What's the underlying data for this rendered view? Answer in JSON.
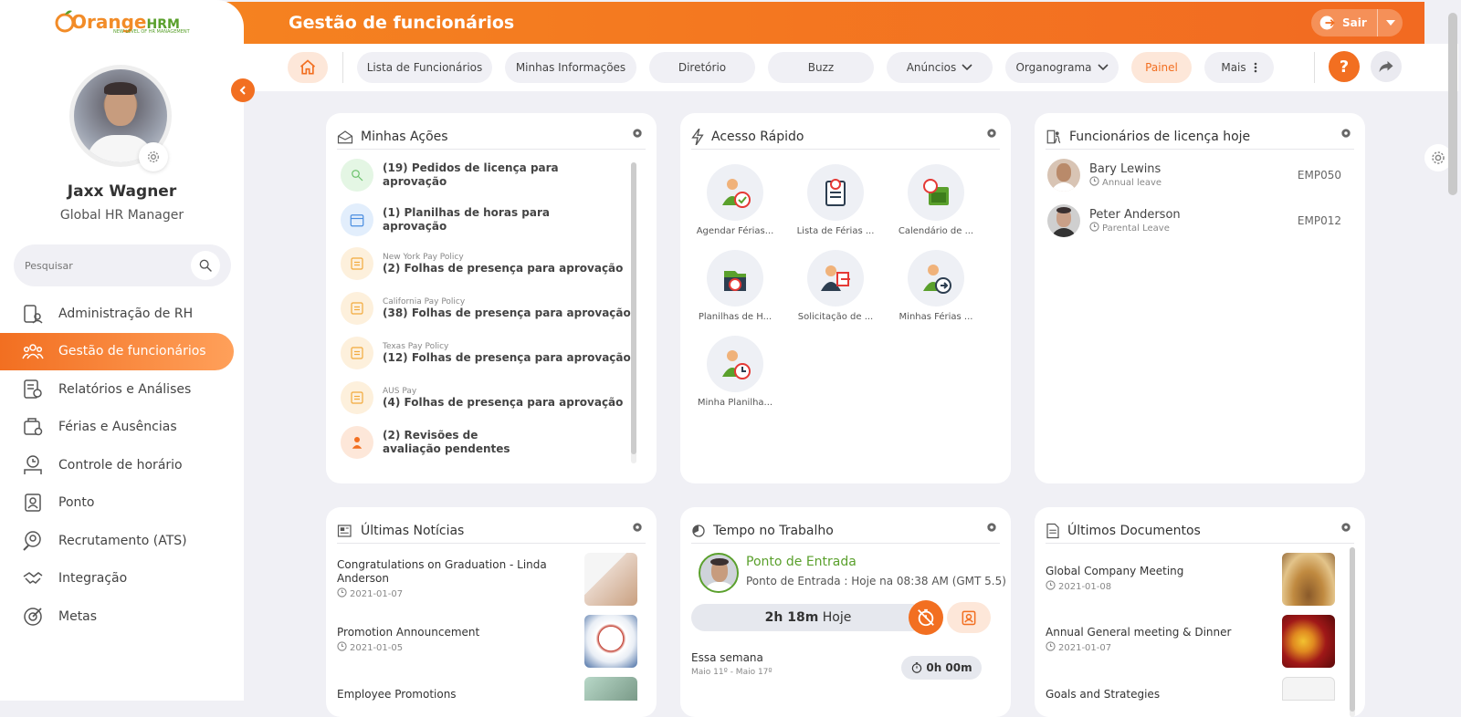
{
  "brand": {
    "name_orange": "Orange",
    "name_hrm": "HRM",
    "tagline": "NEW LEVEL OF HR MANAGEMENT",
    "accent": "#f26f21"
  },
  "user": {
    "name": "Jaxx Wagner",
    "role": "Global HR Manager"
  },
  "search": {
    "placeholder": "Pesquisar"
  },
  "sidebar": {
    "items": [
      {
        "label": "Administração de RH",
        "icon": "admin-icon"
      },
      {
        "label": "Gestão de funcionários",
        "icon": "employees-icon",
        "active": true
      },
      {
        "label": "Relatórios e Análises",
        "icon": "reports-icon"
      },
      {
        "label": "Férias e Ausências",
        "icon": "leave-icon"
      },
      {
        "label": "Controle de horário",
        "icon": "time-icon"
      },
      {
        "label": "Ponto",
        "icon": "attendance-icon"
      },
      {
        "label": "Recrutamento (ATS)",
        "icon": "recruitment-icon"
      },
      {
        "label": "Integração",
        "icon": "onboarding-icon"
      },
      {
        "label": "Metas",
        "icon": "goals-icon"
      }
    ]
  },
  "header": {
    "title": "Gestão de funcionários",
    "logout": "Sair"
  },
  "nav": {
    "items": [
      "Lista de Funcionários",
      "Minhas Informações",
      "Diretório",
      "Buzz",
      "Anúncios",
      "Organograma",
      "Painel",
      "Mais"
    ],
    "help": "?"
  },
  "my_actions": {
    "title": "Minhas Ações",
    "items": [
      {
        "sub": "",
        "text": "(19) Pedidos de licença para aprovação"
      },
      {
        "sub": "",
        "text": "(1) Planilhas de horas para aprovação"
      },
      {
        "sub": "New York Pay Policy",
        "text": "(2) Folhas de presença para aprovação"
      },
      {
        "sub": "California Pay Policy",
        "text": "(38) Folhas de presença para aprovação"
      },
      {
        "sub": "Texas Pay Policy",
        "text": "(12) Folhas de presença para aprovação"
      },
      {
        "sub": "AUS Pay",
        "text": "(4) Folhas de presença para aprovação"
      },
      {
        "sub": "",
        "text": "(2) Revisões de avaliação pendentes"
      }
    ]
  },
  "quick_access": {
    "title": "Acesso Rápido",
    "items": [
      "Agendar Férias...",
      "Lista de Férias ...",
      "Calendário de ...",
      "Planilhas de H...",
      "Solicitação de ...",
      "Minhas Férias ...",
      "Minha Planilha..."
    ]
  },
  "on_leave": {
    "title": "Funcionários de licença hoje",
    "items": [
      {
        "name": "Bary Lewins",
        "type": "Annual leave",
        "id": "EMP050"
      },
      {
        "name": "Peter Anderson",
        "type": "Parental Leave",
        "id": "EMP012"
      }
    ]
  },
  "news": {
    "title": "Últimas Notícias",
    "items": [
      {
        "title": "Congratulations on Graduation - Linda Anderson",
        "date": "2021-01-07"
      },
      {
        "title": "Promotion Announcement",
        "date": "2021-01-05"
      },
      {
        "title": "Employee Promotions",
        "date": ""
      }
    ]
  },
  "time_at_work": {
    "title": "Tempo no Trabalho",
    "status": "Ponto de Entrada",
    "detail": "Ponto de Entrada : Hoje na 08:38 AM (GMT 5.5)",
    "today_hours": "2h 18m",
    "today_label": "Hoje",
    "week_label": "Essa semana",
    "week_range": "Maio 11º - Maio 17º",
    "week_total": "0h 00m"
  },
  "documents": {
    "title": "Últimos Documentos",
    "items": [
      {
        "title": "Global Company Meeting",
        "date": "2021-01-08"
      },
      {
        "title": "Annual General meeting & Dinner",
        "date": "2021-01-07"
      },
      {
        "title": "Goals and Strategies",
        "date": ""
      }
    ]
  }
}
